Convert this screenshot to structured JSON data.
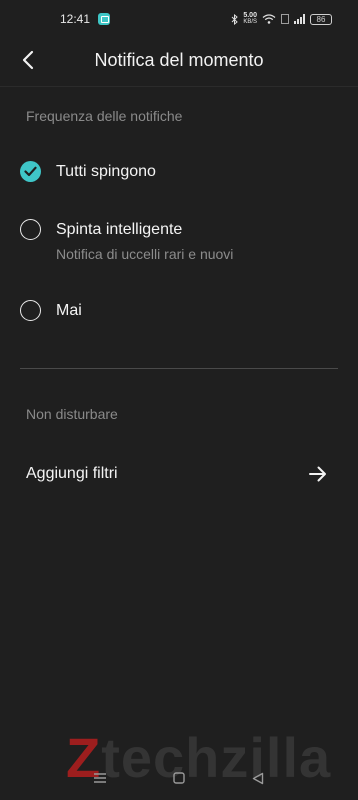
{
  "status_bar": {
    "time": "12:41",
    "net_speed_value": "5.00",
    "net_speed_unit": "KB/S",
    "battery": "86"
  },
  "header": {
    "title": "Notifica del momento",
    "back_icon": "chevron-left-icon"
  },
  "frequency": {
    "section_label": "Frequenza delle notifiche",
    "options": [
      {
        "label": "Tutti spingono",
        "sub": "",
        "selected": true
      },
      {
        "label": "Spinta intelligente",
        "sub": "Notifica di uccelli rari e nuovi",
        "selected": false
      },
      {
        "label": "Mai",
        "sub": "",
        "selected": false
      }
    ]
  },
  "do_not_disturb": {
    "section_label": "Non disturbare",
    "add_filters_label": "Aggiungi filtri",
    "arrow_icon": "arrow-right-icon"
  },
  "watermark": {
    "text_prefix": "Z",
    "text_main": "techzilla"
  },
  "colors": {
    "background": "#1f1f1f",
    "accent": "#3fc6c8",
    "secondary_text": "#8a8a8a"
  }
}
